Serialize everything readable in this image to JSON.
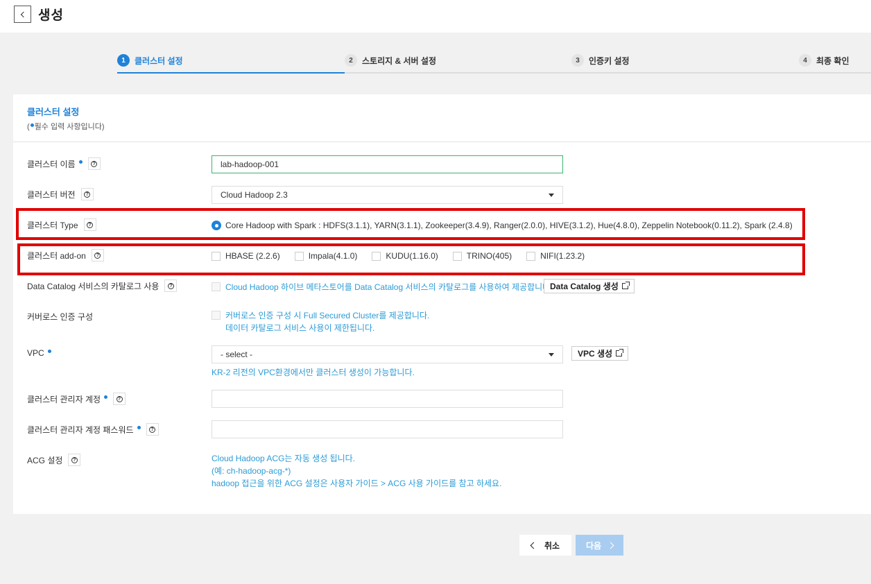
{
  "header": {
    "title": "생성"
  },
  "steps": [
    {
      "num": "1",
      "label": "클러스터 설정",
      "active": true
    },
    {
      "num": "2",
      "label": "스토리지 & 서버 설정",
      "active": false
    },
    {
      "num": "3",
      "label": "인증키 설정",
      "active": false
    },
    {
      "num": "4",
      "label": "최종 확인",
      "active": false
    }
  ],
  "panel": {
    "title": "클러스터 설정",
    "subtitle_prefix": "(",
    "subtitle_text": "필수 입력 사항입니다)"
  },
  "form": {
    "cluster_name": {
      "label": "클러스터 이름",
      "value": "lab-hadoop-001"
    },
    "cluster_version": {
      "label": "클러스터 버전",
      "value": "Cloud Hadoop 2.3"
    },
    "cluster_type": {
      "label": "클러스터 Type",
      "option": "Core Hadoop with Spark : HDFS(3.1.1), YARN(3.1.1), Zookeeper(3.4.9), Ranger(2.0.0), HIVE(3.1.2), Hue(4.8.0), Zeppelin Notebook(0.11.2), Spark (2.4.8)"
    },
    "cluster_addon": {
      "label": "클러스터 add-on",
      "options": [
        "HBASE (2.2.6)",
        "Impala(4.1.0)",
        "KUDU(1.16.0)",
        "TRINO(405)",
        "NIFI(1.23.2)"
      ]
    },
    "data_catalog": {
      "label": "Data Catalog 서비스의 카탈로그 사용",
      "text": "Cloud Hadoop 하이브 메타스토어를 Data Catalog 서비스의 카탈로그를 사용하여 제공합니다.",
      "button": "Data Catalog 생성"
    },
    "kerberos": {
      "label": "커버로스 인증 구성",
      "line1": "커버로스 인증 구성 시 Full Secured Cluster를 제공합니다.",
      "line2": "데이터 카탈로그 서비스 사용이 제한됩니다."
    },
    "vpc": {
      "label": "VPC",
      "value": "- select -",
      "button": "VPC 생성",
      "hint": "KR-2 리전의 VPC환경에서만 클러스터 생성이 가능합니다."
    },
    "admin_account": {
      "label": "클러스터 관리자 계정",
      "value": ""
    },
    "admin_password": {
      "label": "클러스터 관리자 계정 패스워드",
      "value": ""
    },
    "acg": {
      "label": "ACG 설정",
      "line1": "Cloud Hadoop ACG는 자동 생성 됩니다.",
      "line2": "(예: ch-hadoop-acg-*)",
      "line3": "hadoop 접근을 위한 ACG 설정은 사용자 가이드 > ACG 사용 가이드를 참고 하세요."
    }
  },
  "footer": {
    "cancel": "취소",
    "next": "다음"
  },
  "colors": {
    "accent": "#1f82d8",
    "info": "#2b9bd6",
    "highlight": "#e00000",
    "next_disabled": "#a9cdf0"
  }
}
